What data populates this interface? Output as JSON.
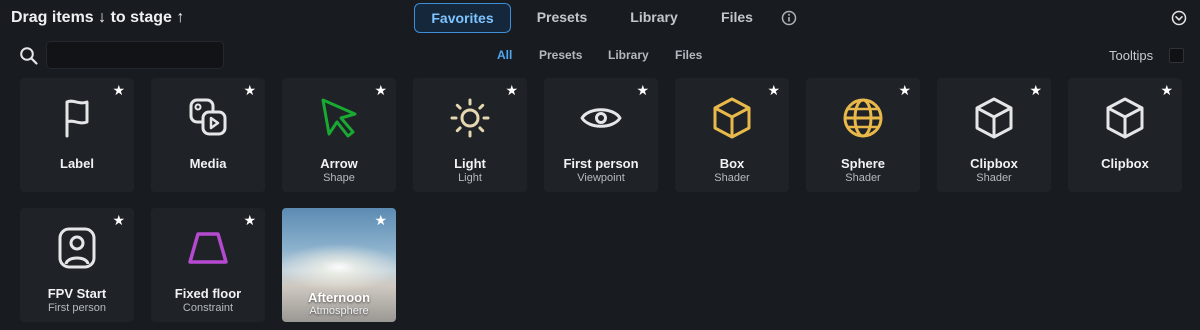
{
  "header": {
    "title": "Drag items ↓ to stage ↑",
    "tabs": [
      {
        "label": "Favorites",
        "active": true
      },
      {
        "label": "Presets",
        "active": false
      },
      {
        "label": "Library",
        "active": false
      },
      {
        "label": "Files",
        "active": false
      }
    ],
    "info_icon": "info-circle-icon",
    "collapse_icon": "chevron-down-circle-icon"
  },
  "toolbar": {
    "search_icon": "search-icon",
    "search_value": "",
    "filters": [
      {
        "label": "All",
        "active": true
      },
      {
        "label": "Presets",
        "active": false
      },
      {
        "label": "Library",
        "active": false
      },
      {
        "label": "Files",
        "active": false
      }
    ],
    "tooltips_label": "Tooltips",
    "tooltips_checked": false
  },
  "items": [
    {
      "name": "Label",
      "sub": "",
      "icon": "flag-icon",
      "color": "#e4e6e8",
      "starred": true
    },
    {
      "name": "Media",
      "sub": "",
      "icon": "media-icon",
      "color": "#e4e6e8",
      "starred": true
    },
    {
      "name": "Arrow",
      "sub": "Shape",
      "icon": "arrow-cursor-icon",
      "color": "#19a832",
      "starred": true
    },
    {
      "name": "Light",
      "sub": "Light",
      "icon": "sun-icon",
      "color": "#e6d7b0",
      "starred": true
    },
    {
      "name": "First person",
      "sub": "Viewpoint",
      "icon": "eye-icon",
      "color": "#e4e6e8",
      "starred": true
    },
    {
      "name": "Box",
      "sub": "Shader",
      "icon": "cube-icon",
      "color": "#e8b84a",
      "starred": true
    },
    {
      "name": "Sphere",
      "sub": "Shader",
      "icon": "globe-icon",
      "color": "#e8b84a",
      "starred": true
    },
    {
      "name": "Clipbox",
      "sub": "Shader",
      "icon": "cube-icon",
      "color": "#e4e6e8",
      "starred": true
    },
    {
      "name": "Clipbox",
      "sub": "",
      "icon": "cube-icon",
      "color": "#e4e6e8",
      "starred": true
    },
    {
      "name": "FPV Start",
      "sub": "First person",
      "icon": "user-frame-icon",
      "color": "#e4e6e8",
      "starred": true
    },
    {
      "name": "Fixed floor",
      "sub": "Constraint",
      "icon": "trapezoid-icon",
      "color": "#b54ad1",
      "starred": true
    },
    {
      "name": "Afternoon",
      "sub": "Atmosphere",
      "icon": "sky-thumbnail",
      "color": "#8ab0cc",
      "starred": true
    }
  ]
}
